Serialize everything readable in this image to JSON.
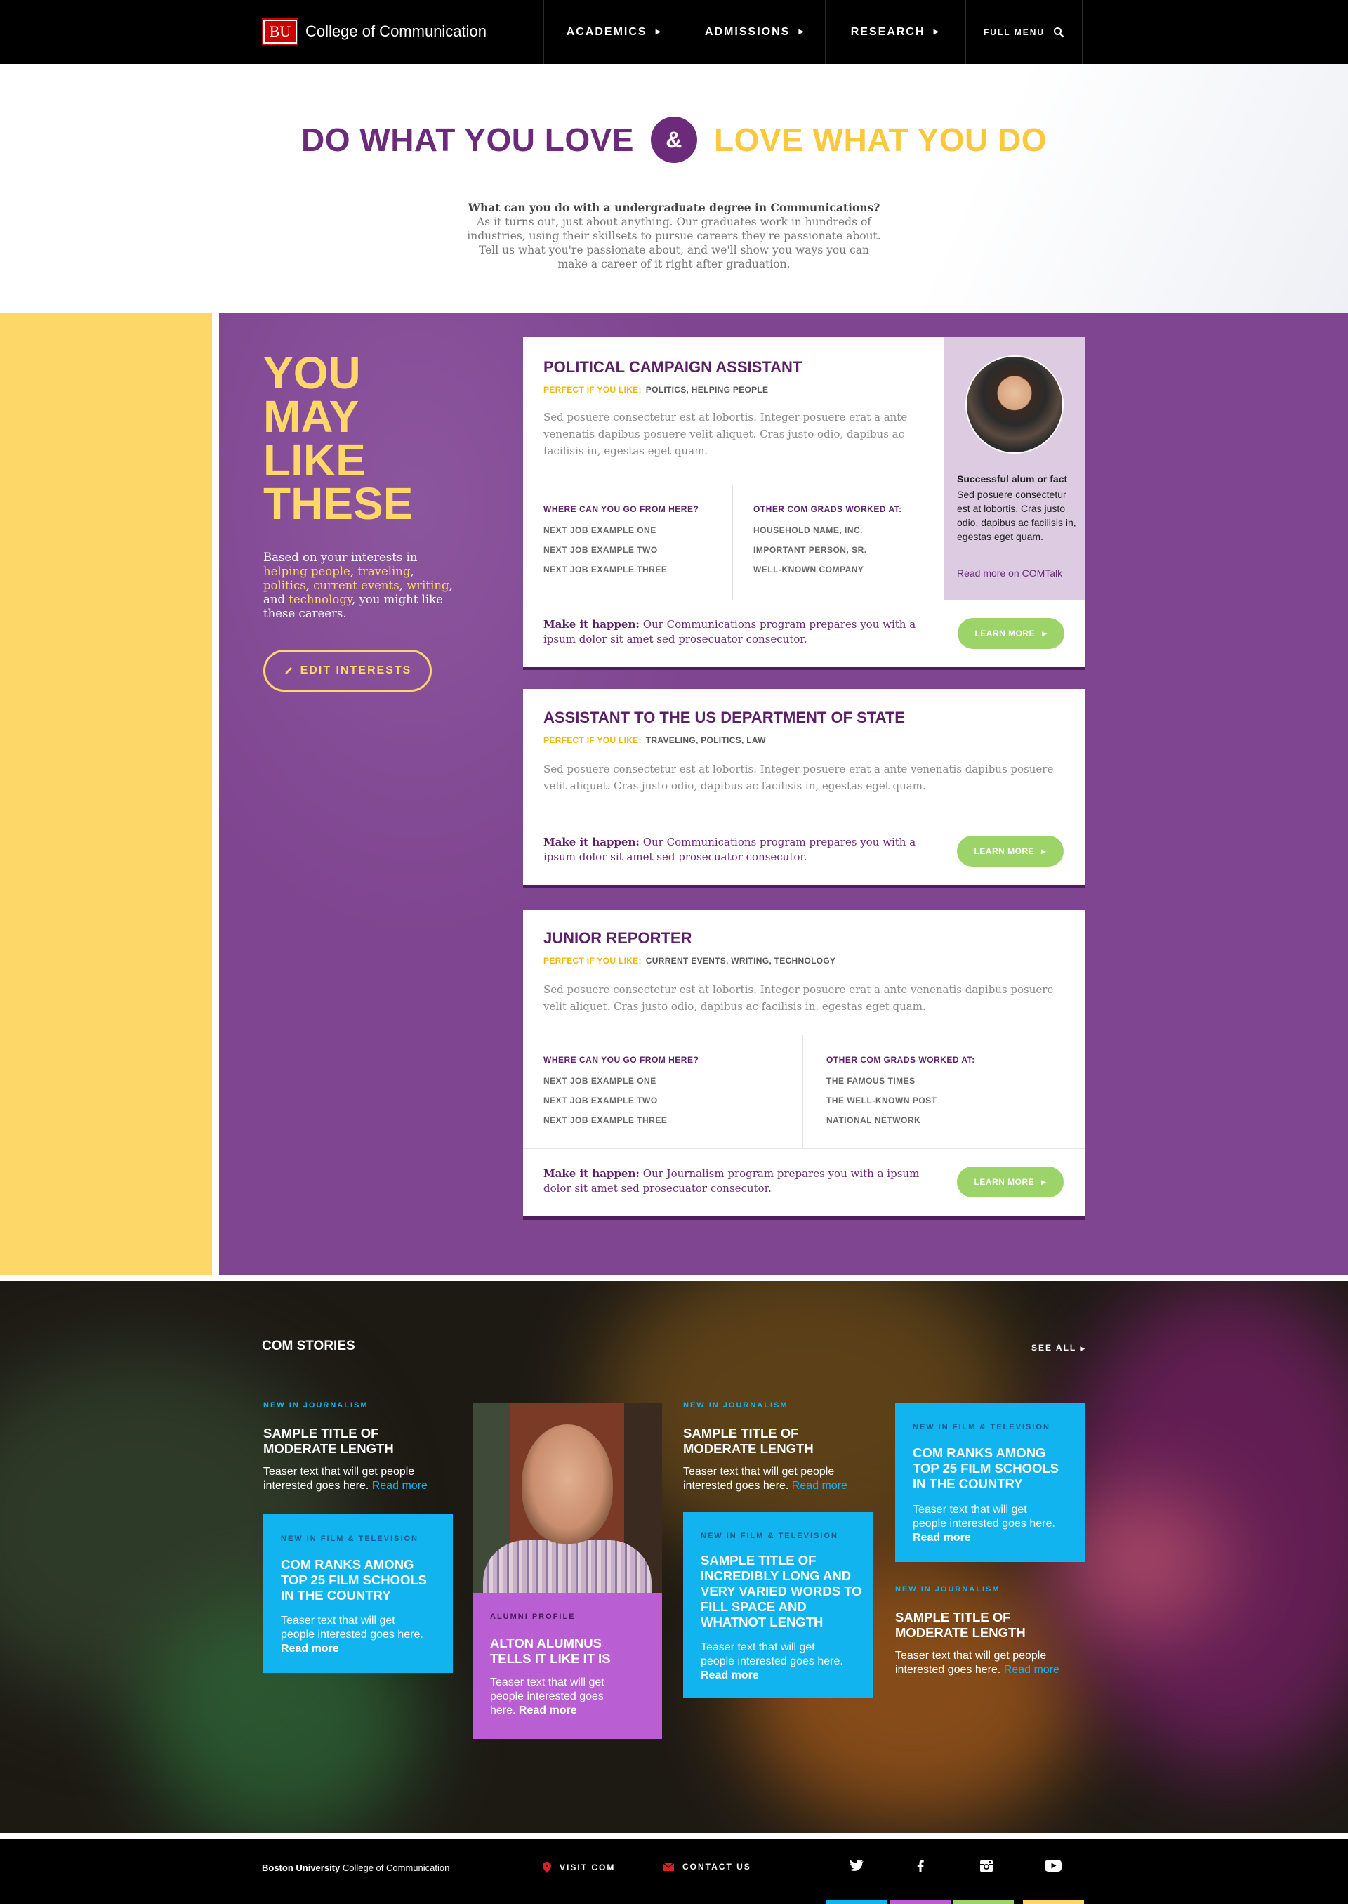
{
  "nav": {
    "logo_text": "BU",
    "college": "College of Communication",
    "items": [
      {
        "label": "ACADEMICS"
      },
      {
        "label": "ADMISSIONS"
      },
      {
        "label": "RESEARCH"
      },
      {
        "label": "FULL MENU"
      }
    ]
  },
  "hero": {
    "headline_left": "DO WHAT YOU LOVE",
    "amp": "&",
    "headline_right": "LOVE WHAT YOU DO",
    "intro_bold": "What can you do with a undergraduate degree in Communications?",
    "intro_rest": " As it turns out, just about anything. Our graduates work in hundreds of industries, using their skillsets to pursue careers they're passionate about. Tell us what you're passionate about, and we'll show you ways you can make a career of it right after graduation."
  },
  "interests": {
    "heading_lines": [
      "YOU",
      "MAY",
      "LIKE",
      "THESE"
    ],
    "desc_prefix": "Based on your interests in",
    "desc_tags": [
      "helping people",
      "traveling",
      "politics",
      "current events",
      "writing",
      "technology"
    ],
    "desc_suffix": "you might like these careers.",
    "edit_button": "EDIT INTERESTS"
  },
  "cards": [
    {
      "title": "POLITICAL CAMPAIGN ASSISTANT",
      "perfect_label": "PERFECT IF YOU LIKE:",
      "perfect_value": "POLITICS, HELPING PEOPLE",
      "description": "Sed posuere consectetur est at lobortis. Integer posuere erat a ante venenatis dapibus posuere velit aliquet. Cras justo odio, dapibus ac facilisis in, egestas eget quam.",
      "col1_heading": "WHERE CAN YOU GO FROM HERE?",
      "col1_items": [
        "NEXT JOB EXAMPLE ONE",
        "NEXT JOB EXAMPLE TWO",
        "NEXT JOB EXAMPLE THREE"
      ],
      "col2_heading": "OTHER COM GRADS WORKED AT:",
      "col2_items": [
        "HOUSEHOLD NAME, INC.",
        "IMPORTANT PERSON, SR.",
        "WELL-KNOWN COMPANY"
      ],
      "make_label": "Make it happen:",
      "make_text": " Our Communications program prepares you with a ipsum dolor sit amet sed prosecuator consecutor.",
      "button": "LEARN MORE",
      "side_title": "Successful alum or fact",
      "side_body": "Sed posuere consectetur est at lobortis. Cras justo odio, dapibus ac facilisis in, egestas eget quam.",
      "side_link": "Read more on COMTalk"
    },
    {
      "title": "ASSISTANT TO THE US DEPARTMENT OF STATE",
      "perfect_label": "PERFECT IF YOU LIKE:",
      "perfect_value": "TRAVELING, POLITICS, LAW",
      "description": "Sed posuere consectetur est at lobortis. Integer posuere erat a ante venenatis dapibus posuere velit aliquet. Cras justo odio, dapibus ac facilisis in, egestas eget quam.",
      "make_label": "Make it happen:",
      "make_text": " Our Communications program prepares you with a ipsum dolor sit amet sed prosecuator consecutor.",
      "button": "LEARN MORE"
    },
    {
      "title": "JUNIOR REPORTER",
      "perfect_label": "PERFECT IF YOU LIKE:",
      "perfect_value": "CURRENT EVENTS, WRITING, TECHNOLOGY",
      "description": "Sed posuere consectetur est at lobortis. Integer posuere erat a ante venenatis dapibus posuere velit aliquet. Cras justo odio, dapibus ac facilisis in, egestas eget quam.",
      "col1_heading": "WHERE CAN YOU GO FROM HERE?",
      "col1_items": [
        "NEXT JOB EXAMPLE ONE",
        "NEXT JOB EXAMPLE TWO",
        "NEXT JOB EXAMPLE THREE"
      ],
      "col2_heading": "OTHER COM GRADS WORKED AT:",
      "col2_items": [
        "THE FAMOUS TIMES",
        "THE WELL-KNOWN POST",
        "NATIONAL NETWORK"
      ],
      "make_label": "Make it happen:",
      "make_text": " Our Journalism program prepares you with a ipsum dolor sit amet sed prosecuator consecutor.",
      "button": "LEARN MORE"
    }
  ],
  "stories": {
    "title": "COM STORIES",
    "see_all": "SEE ALL",
    "read_more": "Read more",
    "items": [
      {
        "category": "NEW IN JOURNALISM",
        "title": "SAMPLE TITLE OF MODERATE LENGTH",
        "teaser": "Teaser text that will get people interested goes here."
      },
      {
        "category": "NEW IN FILM & TELEVISION",
        "title": "COM RANKS AMONG TOP 25 FILM SCHOOLS IN THE COUNTRY",
        "teaser": "Teaser text that will get people interested goes here."
      },
      {
        "category": "ALUMNI PROFILE",
        "title": "ALTON ALUMNUS TELLS IT LIKE IT IS",
        "teaser": "Teaser text that will get people interested goes here."
      },
      {
        "category": "NEW IN JOURNALISM",
        "title": "SAMPLE TITLE OF MODERATE LENGTH",
        "teaser": "Teaser text that will get people interested goes here."
      },
      {
        "category": "NEW IN FILM & TELEVISION",
        "title": "SAMPLE TITLE OF INCREDIBLY LONG AND VERY VARIED WORDS TO FILL SPACE AND WHATNOT LENGTH",
        "teaser": "Teaser text that will get people interested goes here."
      },
      {
        "category": "NEW IN FILM & TELEVISION",
        "title": "COM RANKS AMONG TOP 25 FILM SCHOOLS IN THE COUNTRY",
        "teaser": "Teaser text that will get people interested goes here."
      },
      {
        "category": "NEW IN JOURNALISM",
        "title": "SAMPLE TITLE OF MODERATE LENGTH",
        "teaser": "Teaser text that will get people interested goes here."
      }
    ]
  },
  "footer": {
    "brand_bold": "Boston University",
    "brand_rest": " College of Communication",
    "visit": "VISIT COM",
    "contact": "CONTACT US",
    "social": [
      "twitter-icon",
      "facebook-icon",
      "instagram-icon",
      "youtube-icon"
    ],
    "bar_colors": [
      "#11b4ef",
      "#b95fd3",
      "#9cd46a",
      "#fdd768"
    ]
  },
  "colors": {
    "purple": "#7f4590",
    "dark_purple": "#5b2068",
    "yellow": "#fdd768",
    "green": "#9cd46a",
    "blue": "#11b4ef",
    "violet": "#b95fd3"
  }
}
